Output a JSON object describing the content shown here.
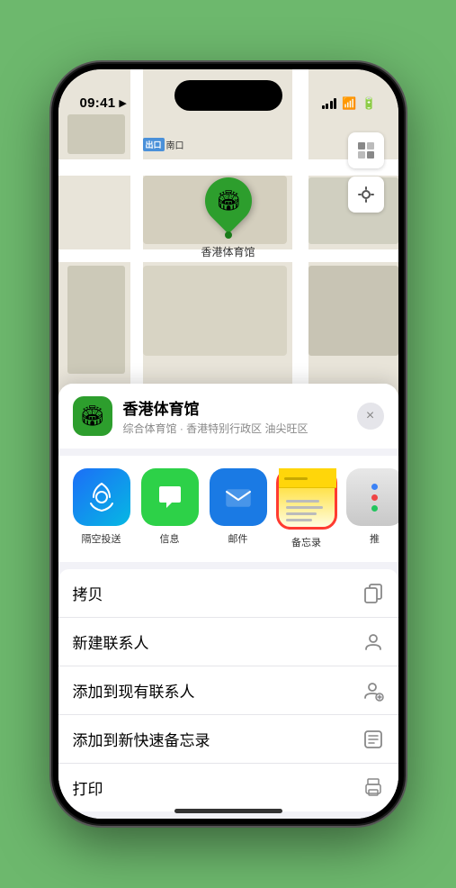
{
  "status_bar": {
    "time": "09:41",
    "nav_arrow": "▶"
  },
  "map": {
    "exit_label_tag": "出口",
    "exit_label_text": "南口",
    "stadium_name": "香港体育馆",
    "controls": {
      "map_icon": "🗺",
      "location_icon": "⬆"
    }
  },
  "location_card": {
    "name": "香港体育馆",
    "description": "综合体育馆 · 香港特别行政区 油尖旺区",
    "close_label": "×"
  },
  "share_items": [
    {
      "id": "airdrop",
      "label": "隔空投送"
    },
    {
      "id": "messages",
      "label": "信息"
    },
    {
      "id": "mail",
      "label": "邮件"
    },
    {
      "id": "notes",
      "label": "备忘录"
    },
    {
      "id": "more",
      "label": "推"
    }
  ],
  "action_items": [
    {
      "label": "拷贝",
      "icon": "⧉"
    },
    {
      "label": "新建联系人",
      "icon": "👤"
    },
    {
      "label": "添加到现有联系人",
      "icon": "👤"
    },
    {
      "label": "添加到新快速备忘录",
      "icon": "▦"
    },
    {
      "label": "打印",
      "icon": "🖨"
    }
  ]
}
